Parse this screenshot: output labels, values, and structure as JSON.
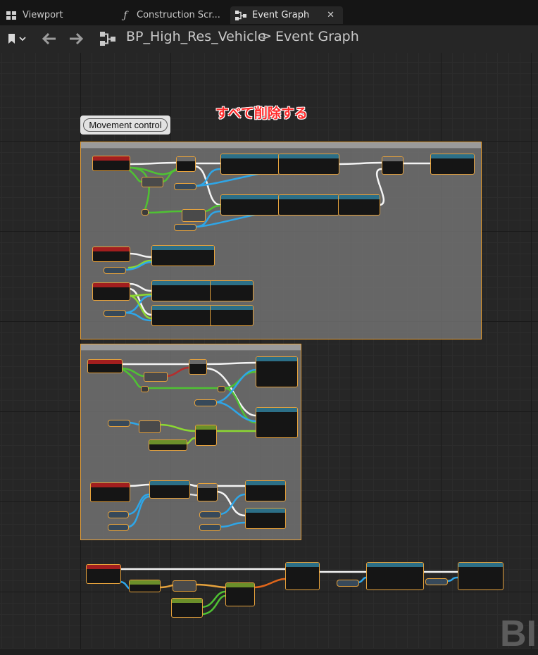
{
  "tabs": [
    {
      "label": "Viewport",
      "icon": "grid-icon"
    },
    {
      "label": "Construction Scr...",
      "icon": "function-icon"
    },
    {
      "label": "Event Graph",
      "icon": "graph-icon",
      "active": true
    }
  ],
  "toolbar": {
    "breadcrumb_root": "BP_High_Res_Vehicle",
    "breadcrumb_separator": ">",
    "breadcrumb_current": "Event Graph"
  },
  "graph": {
    "comment_title": "Movement control",
    "annotation_jp": "すべて削除する",
    "watermark": "BI"
  },
  "colors": {
    "node_border": "#e6a23c",
    "exec_wire": "#ffffff",
    "bool_wire": "#7fe03a",
    "object_wire": "#2ea6e8",
    "float_wire": "#9bd33a",
    "red_event_header": "#a21e1e",
    "annotation_red": "#ff2a2a"
  }
}
